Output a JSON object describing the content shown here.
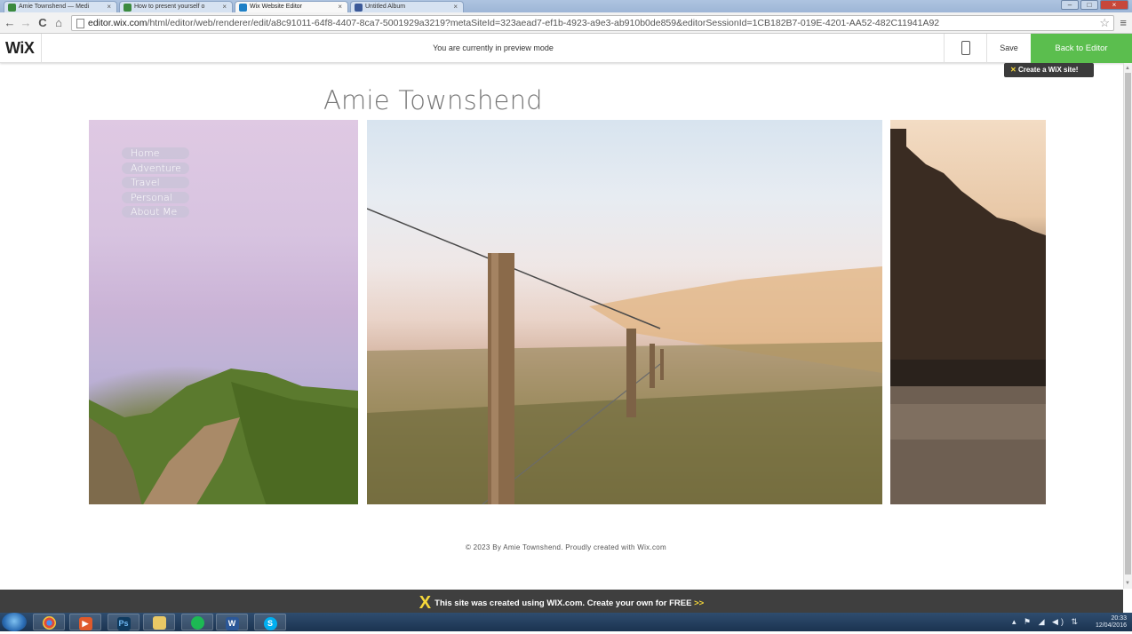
{
  "browser": {
    "tabs": [
      {
        "label": "Amie Townshend — Medi",
        "color": "#3b8a3e"
      },
      {
        "label": "How to present yourself o",
        "color": "#3b8a3e"
      },
      {
        "label": "Wix Website Editor",
        "color": "#1f80c6"
      },
      {
        "label": "Untitled Album",
        "color": "#3b5998"
      }
    ],
    "url_host": "editor.wix.com",
    "url_path": "/html/editor/web/renderer/edit/a8c91011-64f8-4407-8ca7-5001929a3219?metaSiteId=323aead7-ef1b-4923-a9e3-ab910b0de859&editorSessionId=1CB182B7-019E-4201-AA52-482C11941A92",
    "nav": {
      "back": "←",
      "forward": "→",
      "reload": "C",
      "home": "⌂",
      "star": "☆",
      "menu": "≡"
    }
  },
  "wix_bar": {
    "logo": "WiX",
    "preview_message": "You are currently in preview mode",
    "save_label": "Save",
    "back_label": "Back to Editor",
    "tooltip": "Create a WiX site!",
    "accent": "#5bbe4e"
  },
  "site": {
    "title": "Amie Townshend",
    "menu": [
      "Home",
      "Adventure",
      "Travel",
      "Personal",
      "About Me"
    ],
    "footer": "© 2023 By Amie Townshend. Proudly created with Wix.com"
  },
  "banner": {
    "text": "This site was created using WIX.com. Create your own for FREE",
    "arrows": ">>"
  },
  "taskbar": {
    "apps": [
      {
        "name": "chrome",
        "glyph": "",
        "color": "#e7b23a"
      },
      {
        "name": "media",
        "glyph": "",
        "color": "#e05a2b"
      },
      {
        "name": "photoshop",
        "glyph": "Ps",
        "color": "#0f3a5e"
      },
      {
        "name": "explorer",
        "glyph": "",
        "color": "#e9c865"
      },
      {
        "name": "spotify",
        "glyph": "",
        "color": "#1db954"
      },
      {
        "name": "word",
        "glyph": "W",
        "color": "#2b5797"
      },
      {
        "name": "skype",
        "glyph": "S",
        "color": "#00aff0"
      }
    ],
    "time": "20:33",
    "date": "12/04/2016"
  }
}
